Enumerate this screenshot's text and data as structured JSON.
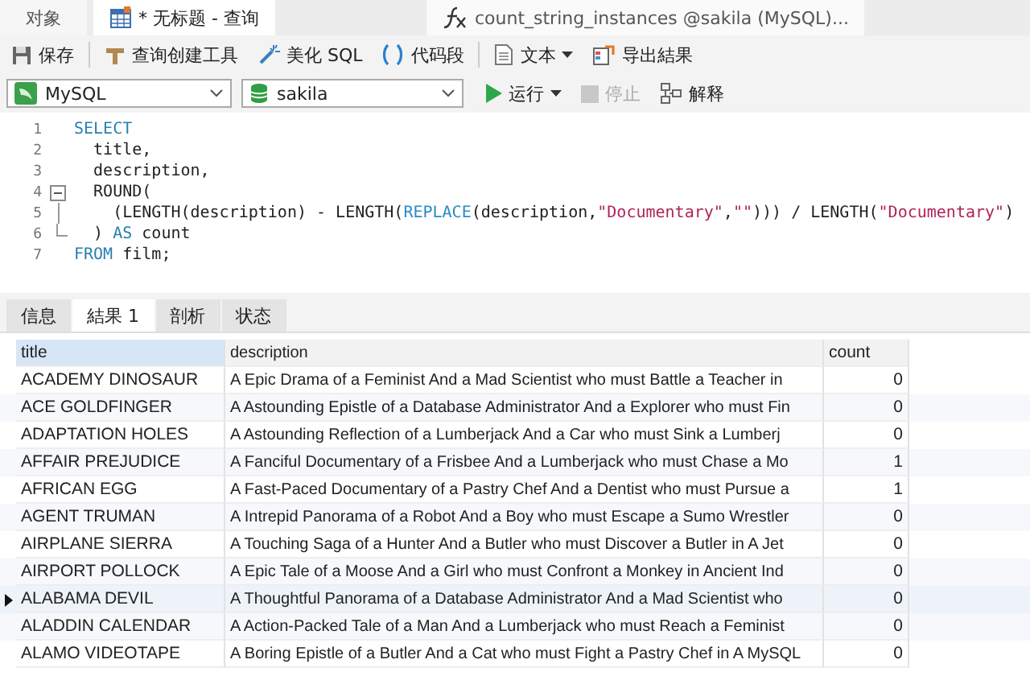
{
  "doc_tabs": [
    {
      "label": "对象",
      "kind": "plain",
      "selected": false
    },
    {
      "label": "* 无标题 - 查询",
      "kind": "query",
      "selected": true
    },
    {
      "label": "count_string_instances @sakila (MySQL)...",
      "kind": "function",
      "selected": false
    }
  ],
  "toolbar": [
    {
      "label": "保存",
      "kind": "save",
      "dropdown": false
    },
    {
      "label": "查询创建工具",
      "kind": "builder",
      "dropdown": false
    },
    {
      "label": "美化 SQL",
      "kind": "beautify",
      "dropdown": false
    },
    {
      "label": "代码段",
      "kind": "snippet",
      "dropdown": false
    },
    {
      "label": "文本",
      "kind": "text",
      "dropdown": true
    },
    {
      "label": "导出結果",
      "kind": "export",
      "dropdown": false
    }
  ],
  "connection": {
    "value": "MySQL"
  },
  "database": {
    "value": "sakila"
  },
  "actions": [
    {
      "label": "运行",
      "kind": "run",
      "dropdown": true,
      "disabled": false
    },
    {
      "label": "停止",
      "kind": "stop",
      "dropdown": false,
      "disabled": true
    },
    {
      "label": "解释",
      "kind": "explain",
      "dropdown": false,
      "disabled": false
    }
  ],
  "code_lines": [
    {
      "number": "1",
      "kind": "plain",
      "segments": [
        {
          "text": "SELECT",
          "kind": "keyword"
        }
      ]
    },
    {
      "number": "2",
      "kind": "plain",
      "segments": [
        {
          "text": "  title,",
          "kind": "plain"
        }
      ]
    },
    {
      "number": "3",
      "kind": "plain",
      "segments": [
        {
          "text": "  description,",
          "kind": "plain"
        }
      ]
    },
    {
      "number": "4",
      "kind": "fold_start",
      "segments": [
        {
          "text": "  ROUND(",
          "kind": "plain"
        }
      ]
    },
    {
      "number": "5",
      "kind": "fold_inside",
      "segments": [
        {
          "text": "    (LENGTH(description) - LENGTH(",
          "kind": "plain"
        },
        {
          "text": "REPLACE",
          "kind": "function"
        },
        {
          "text": "(description,",
          "kind": "plain"
        },
        {
          "text": "\"Documentary\"",
          "kind": "string"
        },
        {
          "text": ",",
          "kind": "plain"
        },
        {
          "text": "\"\"",
          "kind": "string"
        },
        {
          "text": "))) / LENGTH(",
          "kind": "plain"
        },
        {
          "text": "\"Documentary\"",
          "kind": "string"
        },
        {
          "text": ")",
          "kind": "plain"
        }
      ]
    },
    {
      "number": "6",
      "kind": "fold_end",
      "segments": [
        {
          "text": "  ) ",
          "kind": "plain"
        },
        {
          "text": "AS",
          "kind": "keyword"
        },
        {
          "text": " count",
          "kind": "plain"
        }
      ]
    },
    {
      "number": "7",
      "kind": "plain",
      "segments": [
        {
          "text": "FROM",
          "kind": "keyword"
        },
        {
          "text": " film;",
          "kind": "plain"
        }
      ]
    }
  ],
  "result_tabs": [
    {
      "label": "信息",
      "selected": false
    },
    {
      "label": "結果 1",
      "selected": true
    },
    {
      "label": "剖析",
      "selected": false
    },
    {
      "label": "状态",
      "selected": false
    }
  ],
  "table": {
    "columns": [
      {
        "label": "title",
        "selected": true
      },
      {
        "label": "description",
        "selected": false
      },
      {
        "label": "count",
        "selected": false
      }
    ],
    "rows": [
      {
        "title": "ACADEMY DINOSAUR",
        "description": "A Epic Drama of a Feminist And a Mad Scientist who must Battle a Teacher in",
        "count": "0",
        "selected": false
      },
      {
        "title": "ACE GOLDFINGER",
        "description": "A Astounding Epistle of a Database Administrator And a Explorer who must Fin",
        "count": "0",
        "selected": false
      },
      {
        "title": "ADAPTATION HOLES",
        "description": "A Astounding Reflection of a Lumberjack And a Car who must Sink a Lumberj",
        "count": "0",
        "selected": false
      },
      {
        "title": "AFFAIR PREJUDICE",
        "description": "A Fanciful Documentary of a Frisbee And a Lumberjack who must Chase a Mo",
        "count": "1",
        "selected": false
      },
      {
        "title": "AFRICAN EGG",
        "description": "A Fast-Paced Documentary of a Pastry Chef And a Dentist who must Pursue a",
        "count": "1",
        "selected": false
      },
      {
        "title": "AGENT TRUMAN",
        "description": "A Intrepid Panorama of a Robot And a Boy who must Escape a Sumo Wrestler",
        "count": "0",
        "selected": false
      },
      {
        "title": "AIRPLANE SIERRA",
        "description": "A Touching Saga of a Hunter And a Butler who must Discover a Butler in A Jet",
        "count": "0",
        "selected": false
      },
      {
        "title": "AIRPORT POLLOCK",
        "description": "A Epic Tale of a Moose And a Girl who must Confront a Monkey in Ancient Ind",
        "count": "0",
        "selected": false
      },
      {
        "title": "ALABAMA DEVIL",
        "description": "A Thoughtful Panorama of a Database Administrator And a Mad Scientist who",
        "count": "0",
        "selected": true
      },
      {
        "title": "ALADDIN CALENDAR",
        "description": "A Action-Packed Tale of a Man And a Lumberjack who must Reach a Feminist",
        "count": "0",
        "selected": false
      },
      {
        "title": "ALAMO VIDEOTAPE",
        "description": "A Boring Epistle of a Butler And a Cat who must Fight a Pastry Chef in A MySQL",
        "count": "0",
        "selected": false
      }
    ]
  }
}
